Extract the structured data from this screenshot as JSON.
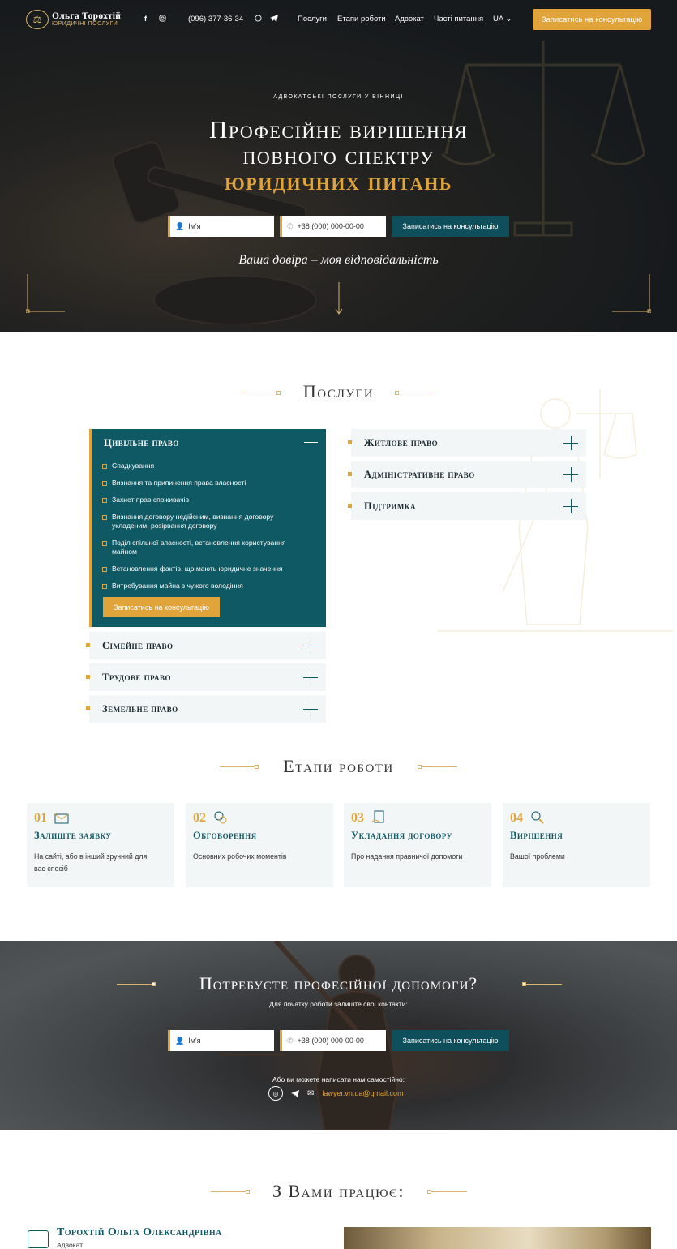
{
  "nav": {
    "brand_name": "Ольга Торохтій",
    "brand_tagline": "ЮРИДИЧНІ ПОСЛУГИ",
    "phone": "(096) 377-36-34",
    "menu": [
      "Послуги",
      "Етапи роботи",
      "Адвокат",
      "Часті питання"
    ],
    "lang": "UA",
    "cta": "Записатись на консультацію"
  },
  "hero": {
    "kicker": "АДВОКАТСЬКІ ПОСЛУГИ У ВІННИЦІ",
    "title_line1": "Професійне вирішення",
    "title_line2": "повного спектру",
    "title_line3": "юридичних питань",
    "name_placeholder": "Ім'я",
    "phone_placeholder": "+38 (000) 000-00-00",
    "submit": "Записатись на консультацію",
    "motto": "Ваша довіра – моя відповідальність"
  },
  "services": {
    "title": "Послуги",
    "open_item": {
      "title": "Цивільне право",
      "items": [
        "Спадкування",
        "Визнання та припинення права власності",
        "Захист прав споживачів",
        "Визнання договору недійсним, визнання договору укладеним, розірвання договору",
        "Поділ спільної власності, встановлення користування майном",
        "Встановлення фактів, що мають юридичне значення",
        "Витребування майна з чужого володіння"
      ],
      "button": "Записатись на консультацію"
    },
    "left_items": [
      "Сімейне право",
      "Трудове право",
      "Земельне право"
    ],
    "right_items": [
      "Житлове право",
      "Адміністративне право",
      "Підтримка"
    ]
  },
  "stages": {
    "title": "Етапи роботи",
    "items": [
      {
        "num": "01",
        "title": "Залиште заявку",
        "desc": "На сайті, або в інший зручний для вас спосіб",
        "icon": "envelope-icon"
      },
      {
        "num": "02",
        "title": "Обговорення",
        "desc": "Основних робочих моментів",
        "icon": "chat-icon"
      },
      {
        "num": "03",
        "title": "Укладання договору",
        "desc": "Про надання правничої допомоги",
        "icon": "contract-icon"
      },
      {
        "num": "04",
        "title": "Вирішення",
        "desc": "Вашої проблеми",
        "icon": "magnifier-icon"
      }
    ]
  },
  "contact_band": {
    "title": "Потребуєте професійної допомоги?",
    "subtitle": "Для початку роботи залиште свої контакти:",
    "name_placeholder": "Ім'я",
    "phone_placeholder": "+38 (000) 000-00-00",
    "submit": "Записатись на консультацію",
    "alt_text": "Або ви можете написати нам самостійно:",
    "email": "lawyer.vn.ua@gmail.com"
  },
  "team": {
    "title": "З Вами працює:",
    "name": "Торохтій Ольга Олександрівна",
    "role": "Адвокат"
  },
  "colors": {
    "accent": "#e0a43a",
    "primary": "#0f5964",
    "light_bg": "#f2f6f7"
  }
}
